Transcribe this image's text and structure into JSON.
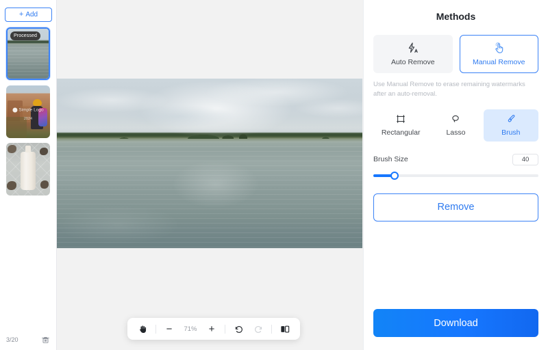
{
  "sidebar": {
    "add_label": "Add",
    "add_icon": "plus-icon",
    "thumbnails": [
      {
        "id": "thumb-1",
        "badge": "Processed",
        "selected": true,
        "alt": "lake-landscape"
      },
      {
        "id": "thumb-2",
        "badge": "",
        "selected": false,
        "alt": "canyon-hiker",
        "watermark_text": "Simple Logo",
        "watermark_year": "2024"
      },
      {
        "id": "thumb-3",
        "badge": "",
        "selected": false,
        "alt": "cosmetic-bottle"
      }
    ],
    "footer": {
      "page_count": "3/20",
      "delete_icon": "trash-icon"
    }
  },
  "canvas": {
    "image_alt": "lake-landscape-preview",
    "toolbar": {
      "pan_icon": "hand-icon",
      "zoom_out_label": "−",
      "zoom_level": "71%",
      "zoom_in_label": "+",
      "undo_icon": "undo-icon",
      "redo_icon": "redo-icon",
      "redo_disabled": true,
      "compare_icon": "compare-split-icon"
    }
  },
  "panel": {
    "title": "Methods",
    "methods": [
      {
        "label": "Auto Remove",
        "icon": "auto-lightning-icon",
        "active": false
      },
      {
        "label": "Manual Remove",
        "icon": "tap-hand-icon",
        "active": true
      }
    ],
    "hint": "Use Manual Remove to erase remaining watermarks after an auto-removal.",
    "tools": [
      {
        "label": "Rectangular",
        "icon": "rectangle-select-icon",
        "active": false
      },
      {
        "label": "Lasso",
        "icon": "lasso-icon",
        "active": false
      },
      {
        "label": "Brush",
        "icon": "brush-icon",
        "active": true
      }
    ],
    "brush_size": {
      "label": "Brush Size",
      "value": "40",
      "percent": 13
    },
    "remove_label": "Remove",
    "download_label": "Download"
  },
  "colors": {
    "accent_blue": "#1677ff",
    "link_blue": "#2f7bf0",
    "active_tool_bg": "#dbeafe",
    "panel_bg": "#ffffff",
    "canvas_bg": "#f2f2f2",
    "hint_gray": "#b6bac1"
  }
}
